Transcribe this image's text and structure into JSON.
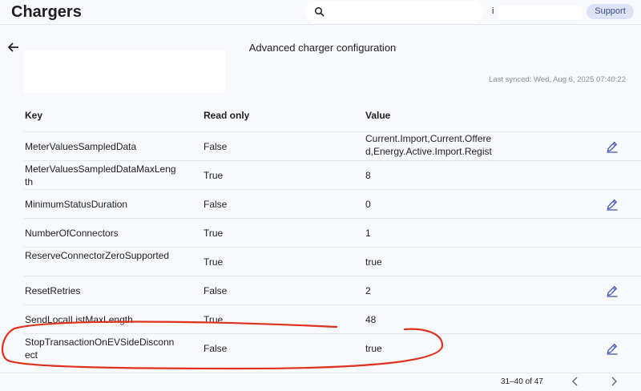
{
  "header": {
    "title": "Chargers",
    "search": {
      "icon": "search-icon",
      "value": ""
    },
    "help_label": "i",
    "support_label": "Support"
  },
  "page": {
    "back_icon": "arrow-left-icon",
    "title": "Advanced charger configuration",
    "last_synced": "Last synced: Wed, Aug 6, 2025 07:40:22"
  },
  "table": {
    "headers": {
      "key": "Key",
      "read_only": "Read only",
      "value": "Value"
    },
    "rows": [
      {
        "key": "MeterValuesSampledData",
        "read_only": "False",
        "value": "Current.Import,Current.Offered,Energy.Active.Import.Register,Power.Active.Import,Te",
        "editable": true
      },
      {
        "key": "MeterValuesSampledDataMaxLength",
        "read_only": "True",
        "value": "8",
        "editable": false
      },
      {
        "key": "MinimumStatusDuration",
        "read_only": "False",
        "value": "0",
        "editable": true
      },
      {
        "key": "NumberOfConnectors",
        "read_only": "True",
        "value": "1",
        "editable": false
      },
      {
        "key": "ReserveConnectorZeroSupported",
        "read_only": "True",
        "value": "true",
        "editable": false
      },
      {
        "key": "ResetRetries",
        "read_only": "False",
        "value": "2",
        "editable": true
      },
      {
        "key": "SendLocalListMaxLength",
        "read_only": "True",
        "value": "48",
        "editable": false
      },
      {
        "key": "StopTransactionOnEVSideDisconnect",
        "read_only": "False",
        "value": "true",
        "editable": true
      }
    ]
  },
  "pagination": {
    "range": "31–40 of 47",
    "prev_icon": "chevron-left-icon",
    "next_icon": "chevron-right-icon"
  },
  "colors": {
    "accent": "#3f51b5",
    "annotation": "#e0301e"
  }
}
